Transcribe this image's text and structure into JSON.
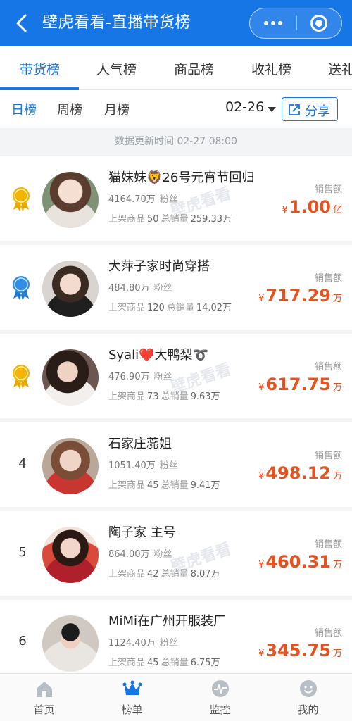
{
  "header": {
    "title": "壁虎看看-直播带货榜"
  },
  "tabs": [
    "带货榜",
    "人气榜",
    "商品榜",
    "收礼榜",
    "送礼"
  ],
  "periods": [
    "日榜",
    "周榜",
    "月榜"
  ],
  "date": "02-26",
  "share_label": "分享",
  "update_time": "数据更新时间 02-27 08:00",
  "labels": {
    "fans": "粉丝",
    "products": "上架商品",
    "total_sales": "总销量",
    "sales_amount": "销售额",
    "yen": "¥"
  },
  "watermark": "壁虎看看",
  "rows": [
    {
      "rank": "1",
      "name": "猫妹妹🦁26号元宵节回归",
      "fans": "4164.70万",
      "products": "50",
      "volume": "259.33万",
      "amount": "1.00",
      "unit": "亿"
    },
    {
      "rank": "2",
      "name": "大萍子家时尚穿搭",
      "fans": "484.80万",
      "products": "120",
      "volume": "14.02万",
      "amount": "717.29",
      "unit": "万"
    },
    {
      "rank": "3",
      "name": "Syali❤️大鸭梨➰",
      "fans": "476.90万",
      "products": "73",
      "volume": "9.63万",
      "amount": "617.75",
      "unit": "万"
    },
    {
      "rank": "4",
      "name": "石家庄蕊姐",
      "fans": "1051.40万",
      "products": "45",
      "volume": "9.41万",
      "amount": "498.12",
      "unit": "万"
    },
    {
      "rank": "5",
      "name": "陶子家 主号",
      "fans": "864.00万",
      "products": "42",
      "volume": "8.07万",
      "amount": "460.31",
      "unit": "万"
    },
    {
      "rank": "6",
      "name": "MiMi在广州开服装厂",
      "fans": "1124.40万",
      "products": "45",
      "volume": "6.75万",
      "amount": "345.75",
      "unit": "万"
    }
  ],
  "bottom_nav": [
    "首页",
    "榜单",
    "监控",
    "我的"
  ],
  "colors": {
    "brand": "#1676e6",
    "sales": "#e8521f",
    "gold": "#f5b400",
    "blue_medal": "#2f8fe8"
  }
}
